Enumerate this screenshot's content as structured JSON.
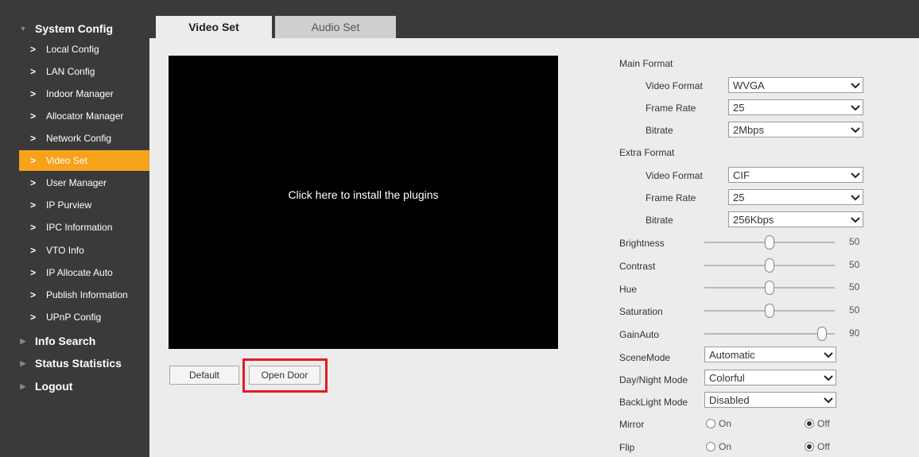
{
  "sidebar": {
    "sections": [
      {
        "label": "System Config"
      },
      {
        "label": "Info Search"
      },
      {
        "label": "Status Statistics"
      },
      {
        "label": "Logout"
      }
    ],
    "items": [
      {
        "label": "Local Config"
      },
      {
        "label": "LAN Config"
      },
      {
        "label": "Indoor Manager"
      },
      {
        "label": "Allocator Manager"
      },
      {
        "label": "Network Config"
      },
      {
        "label": "Video Set"
      },
      {
        "label": "User Manager"
      },
      {
        "label": "IP Purview"
      },
      {
        "label": "IPC Information"
      },
      {
        "label": "VTO Info"
      },
      {
        "label": "IP Allocate Auto"
      },
      {
        "label": "Publish Information"
      },
      {
        "label": "UPnP Config"
      }
    ]
  },
  "tabs": {
    "video": "Video Set",
    "audio": "Audio Set"
  },
  "video": {
    "prompt": "Click here to install the plugins"
  },
  "buttons": {
    "default": "Default",
    "open_door": "Open Door"
  },
  "main_format": {
    "label": "Main Format",
    "video_format_label": "Video Format",
    "video_format": "WVGA",
    "frame_rate_label": "Frame Rate",
    "frame_rate": "25",
    "bitrate_label": "Bitrate",
    "bitrate": "2Mbps"
  },
  "extra_format": {
    "label": "Extra Format",
    "video_format_label": "Video Format",
    "video_format": "CIF",
    "frame_rate_label": "Frame Rate",
    "frame_rate": "25",
    "bitrate_label": "Bitrate",
    "bitrate": "256Kbps"
  },
  "image": {
    "brightness_label": "Brightness",
    "brightness": "50",
    "contrast_label": "Contrast",
    "contrast": "50",
    "hue_label": "Hue",
    "hue": "50",
    "saturation_label": "Saturation",
    "saturation": "50",
    "gain_label": "GainAuto",
    "gain": "90"
  },
  "modes": {
    "scene_label": "SceneMode",
    "scene": "Automatic",
    "daynight_label": "Day/Night Mode",
    "daynight": "Colorful",
    "backlight_label": "BackLight Mode",
    "backlight": "Disabled"
  },
  "mirror": {
    "label": "Mirror",
    "on": "On",
    "off": "Off",
    "selected": "Off"
  },
  "flip": {
    "label": "Flip",
    "on": "On",
    "off": "Off",
    "selected": "Off"
  },
  "colors": {
    "sidebar_bg": "#3a3a3a",
    "accent": "#f7a21b",
    "highlight": "#e01b24"
  }
}
